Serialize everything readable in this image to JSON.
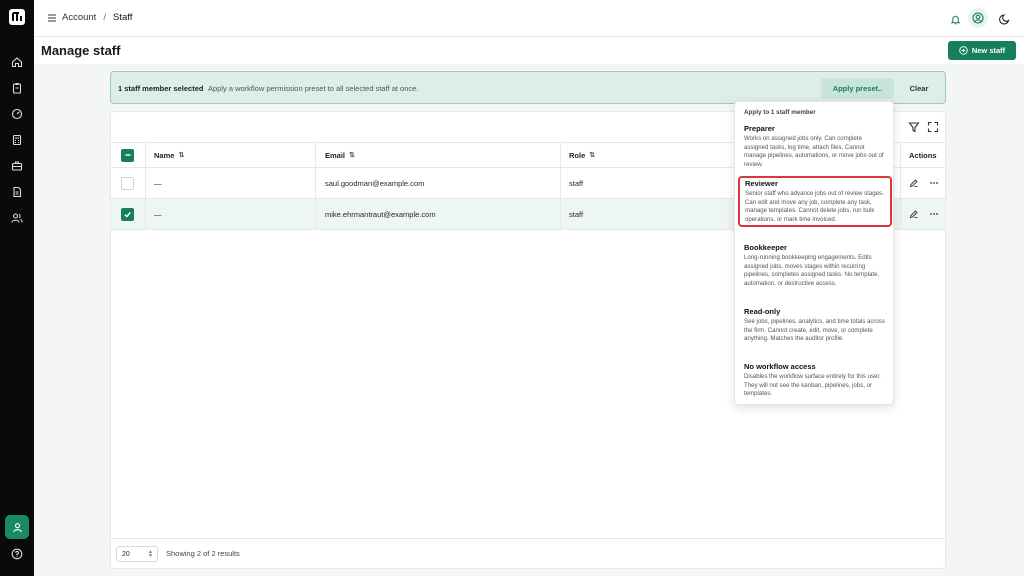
{
  "header": {
    "breadcrumb": [
      "Account",
      "Staff"
    ],
    "separator": "/"
  },
  "page": {
    "title": "Manage staff",
    "new_button": "New staff"
  },
  "selection": {
    "count_text": "1 staff member selected",
    "hint": "Apply a workflow permission preset to all selected staff at once.",
    "apply_label": "Apply preset..",
    "clear_label": "Clear"
  },
  "table": {
    "columns": {
      "name": "Name",
      "email": "Email",
      "role": "Role",
      "actions": "Actions"
    },
    "sort_glyph": "⇅",
    "rows": [
      {
        "name": "—",
        "email": "saul.goodman@example.com",
        "role": "staff",
        "selected": false
      },
      {
        "name": "—",
        "email": "mike.ehrmantraut@example.com",
        "role": "staff",
        "selected": true
      }
    ]
  },
  "footer": {
    "page_size": "20",
    "showing": "Showing 2 of 2 results"
  },
  "dropdown": {
    "heading": "Apply to 1 staff member",
    "options": [
      {
        "title": "Preparer",
        "desc": "Works on assigned jobs only. Can complete assigned tasks, log time, attach files. Cannot manage pipelines, automations, or move jobs out of review."
      },
      {
        "title": "Reviewer",
        "desc": "Senior staff who advance jobs out of review stages. Can edit and move any job, complete any task, manage templates. Cannot delete jobs, run bulk operations, or mark time invoiced."
      },
      {
        "title": "Bookkeeper",
        "desc": "Long-running bookkeeping engagements. Edits assigned jobs, moves stages within recurring pipelines, completes assigned tasks. No template, automation, or destructive access."
      },
      {
        "title": "Read-only",
        "desc": "See jobs, pipelines, analytics, and time totals across the firm. Cannot create, edit, move, or complete anything. Matches the auditor profile."
      },
      {
        "title": "No workflow access",
        "desc": "Disables the workflow surface entirely for this user. They will not see the kanban, pipelines, jobs, or templates."
      }
    ]
  },
  "colors": {
    "accent": "#17805b",
    "highlight": "#d9363e",
    "selection_bg": "#dceee6",
    "sidebar": "#0a0a0a"
  },
  "icons": [
    "logo-icon",
    "home-icon",
    "clipboard-icon",
    "gauge-icon",
    "calculator-icon",
    "briefcase-icon",
    "document-icon",
    "users-icon",
    "user-icon",
    "help-icon",
    "menu-icon",
    "bell-icon",
    "account-icon",
    "moon-icon",
    "plus-circle-icon",
    "filter-icon",
    "fullscreen-icon",
    "edit-icon",
    "more-icon",
    "check-icon",
    "minus-icon"
  ]
}
